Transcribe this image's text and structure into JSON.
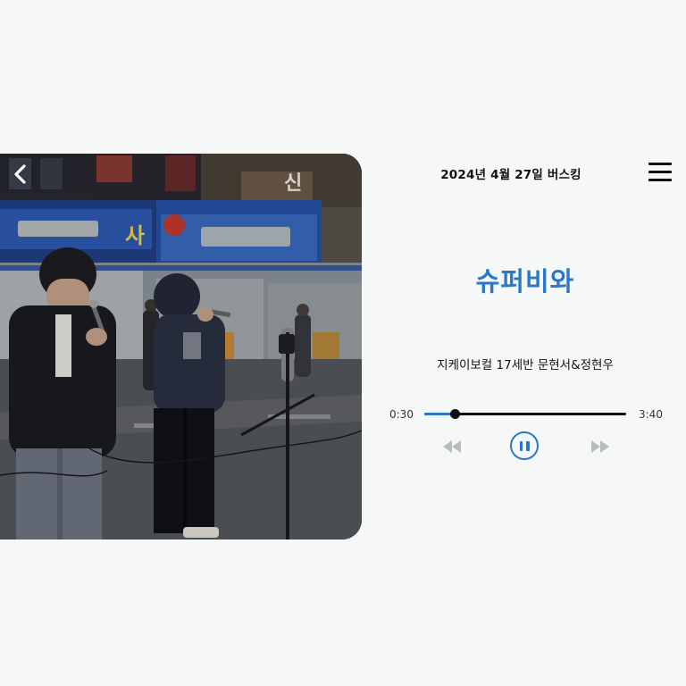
{
  "header": {
    "title": "2024년 4월 27일 버스킹"
  },
  "track": {
    "title": "슈퍼비와",
    "artist": "지케이보컬 17세반 문현서&정현우"
  },
  "player": {
    "current_time": "0:30",
    "total_time": "3:40",
    "progress": 0.15,
    "state": "playing"
  },
  "photo": {
    "signs": [
      "신",
      "사"
    ]
  },
  "icons": {
    "back": "chevron-left-icon",
    "menu": "hamburger-menu-icon",
    "rewind": "rewind-icon",
    "pause": "pause-icon",
    "forward": "fast-forward-icon"
  },
  "colors": {
    "accent": "#2a78c9",
    "background": "#f6f8f8",
    "text": "#111111",
    "controls_inactive": "#b9bcbf"
  }
}
